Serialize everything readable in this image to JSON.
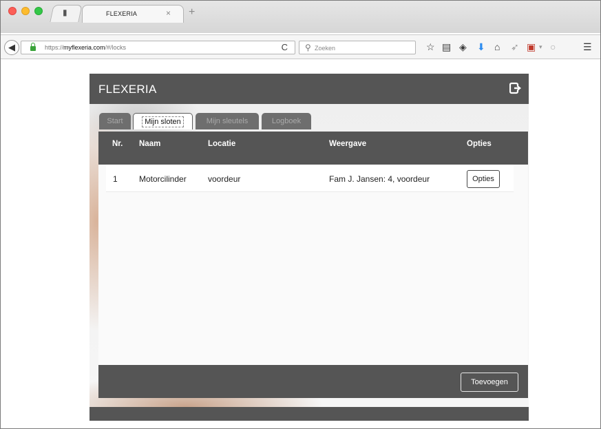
{
  "browser": {
    "tab_title": "FLEXERIA",
    "tab_close": "×",
    "new_tab": "+",
    "url_prefix": "https://",
    "url_host": "myflexeria.com",
    "url_path": "/#/locks",
    "reload": "C",
    "search_placeholder": "Zoeken"
  },
  "app": {
    "brand": "FLEXERIA",
    "tabs": [
      {
        "label": "Start",
        "active": false
      },
      {
        "label": "Mijn sloten",
        "active": true
      },
      {
        "label": "Mijn sleutels",
        "active": false
      },
      {
        "label": "Logboek",
        "active": false
      }
    ],
    "table": {
      "headers": [
        "Nr.",
        "Naam",
        "Locatie",
        "Weergave",
        "Opties"
      ],
      "rows": [
        {
          "nr": "1",
          "naam": "Motorcilinder",
          "locatie": "voordeur",
          "weergave": "Fam J. Jansen: 4, voordeur",
          "button": "Opties"
        }
      ]
    },
    "add_button": "Toevoegen"
  },
  "colors": {
    "header_gray": "#555555",
    "inactive_tab": "#6e6e6e",
    "lock_green": "#3aa33a",
    "download_blue": "#2d8cf0"
  }
}
